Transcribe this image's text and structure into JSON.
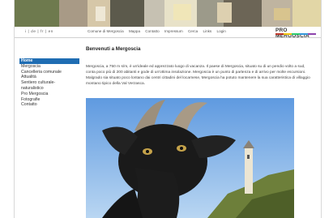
{
  "header": {
    "languages": "i | de | fr | en",
    "nav": [
      "Comune di Mergoscia",
      "Mappa",
      "Contatto",
      "Impressum",
      "Cerca",
      "Links",
      "Login"
    ],
    "logo_text": "PRO MERGOSCIA",
    "logo_colors": [
      "#c0392b",
      "#f1c40f",
      "#2ecc71",
      "#3498db",
      "#8e44ad"
    ]
  },
  "sidebar": {
    "items": [
      {
        "label": "Home",
        "active": true
      },
      {
        "label": "Mergoscia",
        "active": false
      },
      {
        "label": "Cancelleria comunale",
        "active": false
      },
      {
        "label": "Attualità",
        "active": false
      },
      {
        "label": "Sentiero culturale-",
        "active": false
      },
      {
        "label": "naturalistico",
        "active": false
      },
      {
        "label": "Pro Mergoscia",
        "active": false
      },
      {
        "label": "Fotografie",
        "active": false
      },
      {
        "label": "Contatto",
        "active": false
      }
    ]
  },
  "main": {
    "title": "Benvenuti a Mergoscia",
    "paragraph": "Mergoscia, a 750 m s/m, è un'ideale ed apprezzato luogo di vacanza. Il paese di Mergoscia, situato su di un pendio volto a sud, conta poco più di 200 abitanti e gode di un'ottima insolazione. Mergoscia è un punto di partenza e di arrivo per molte escursioni. Malgrado sia situato poco lontano dai centri cittadini del locarnese, Mergoscia ha potuto mantenere la sua caratteristica di villaggio montano tipico della Val Verzasca."
  }
}
